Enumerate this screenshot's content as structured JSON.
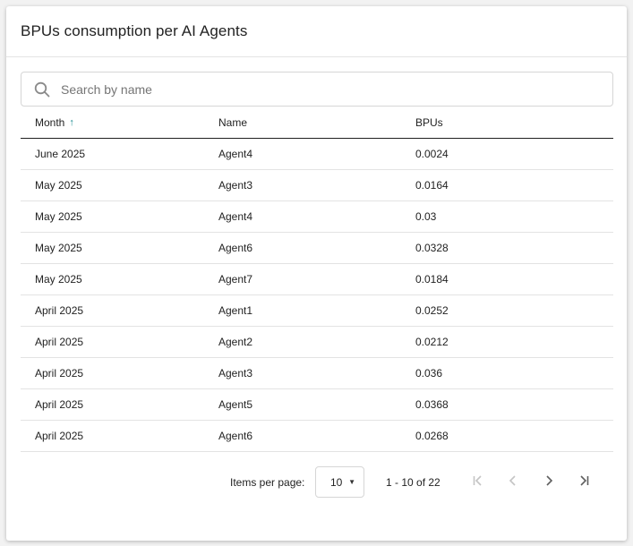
{
  "card": {
    "title": "BPUs consumption per AI Agents"
  },
  "search": {
    "placeholder": "Search by name",
    "value": "",
    "icon": "search-icon"
  },
  "table": {
    "headers": {
      "month": "Month",
      "name": "Name",
      "bpus": "BPUs"
    },
    "sort": {
      "column": "Month",
      "direction": "ascending",
      "arrow": "↑"
    },
    "rows": [
      {
        "month": "June 2025",
        "name": "Agent4",
        "bpus": "0.0024"
      },
      {
        "month": "May 2025",
        "name": "Agent3",
        "bpus": "0.0164"
      },
      {
        "month": "May 2025",
        "name": "Agent4",
        "bpus": "0.03"
      },
      {
        "month": "May 2025",
        "name": "Agent6",
        "bpus": "0.0328"
      },
      {
        "month": "May 2025",
        "name": "Agent7",
        "bpus": "0.0184"
      },
      {
        "month": "April 2025",
        "name": "Agent1",
        "bpus": "0.0252"
      },
      {
        "month": "April 2025",
        "name": "Agent2",
        "bpus": "0.0212"
      },
      {
        "month": "April 2025",
        "name": "Agent3",
        "bpus": "0.036"
      },
      {
        "month": "April 2025",
        "name": "Agent5",
        "bpus": "0.0368"
      },
      {
        "month": "April 2025",
        "name": "Agent6",
        "bpus": "0.0268"
      }
    ]
  },
  "paginator": {
    "items_per_page_label": "Items per page:",
    "page_size": "10",
    "range_label": "1 - 10 of 22",
    "buttons": {
      "first": {
        "icon": "first-page-icon",
        "enabled": false
      },
      "previous": {
        "icon": "chevron-left-icon",
        "enabled": false
      },
      "next": {
        "icon": "chevron-right-icon",
        "enabled": true
      },
      "last": {
        "icon": "last-page-icon",
        "enabled": true
      }
    }
  },
  "colors": {
    "accent": "#1b8a8f",
    "disabled_icon": "#c4c4c4",
    "enabled_icon": "#5f5f5f"
  }
}
